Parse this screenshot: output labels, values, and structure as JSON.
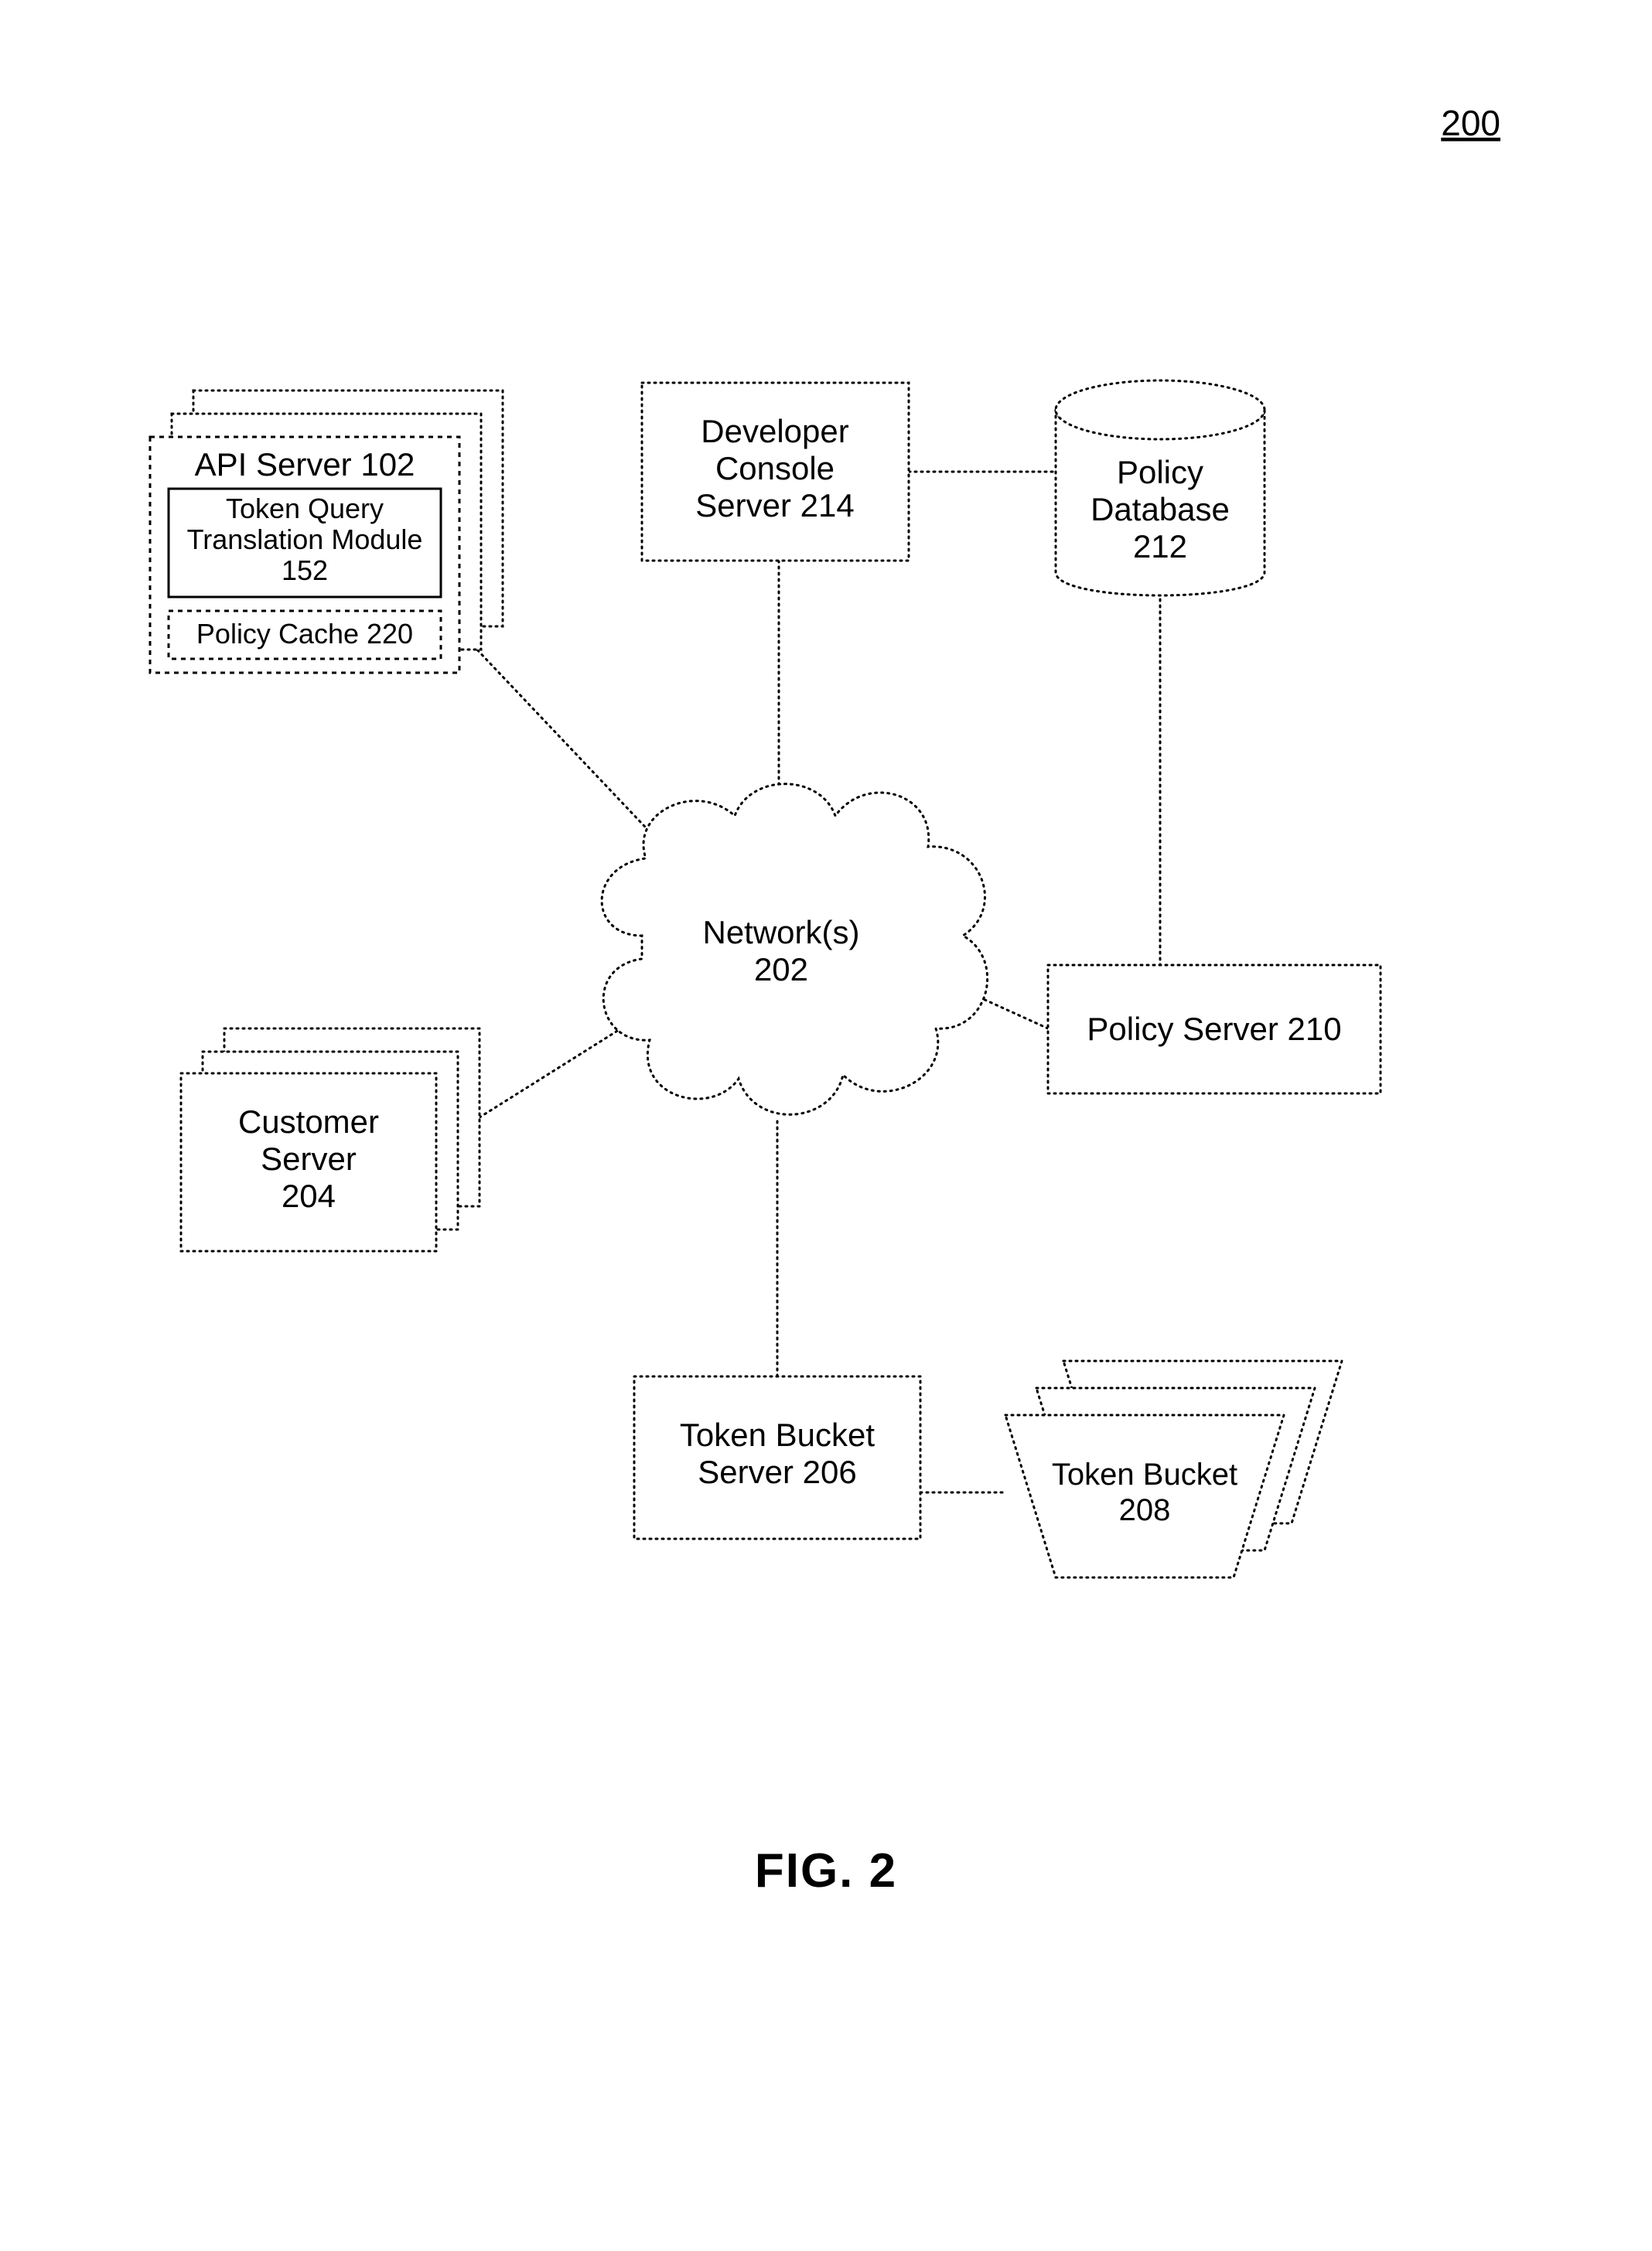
{
  "page_number": "200",
  "figure_caption": "FIG. 2",
  "nodes": {
    "api_server": {
      "title": "API Server 102",
      "module": {
        "l1": "Token Query",
        "l2": "Translation Module",
        "l3": "152"
      },
      "cache": "Policy Cache 220"
    },
    "developer_console": {
      "l1": "Developer",
      "l2": "Console",
      "l3": "Server 214"
    },
    "policy_database": {
      "l1": "Policy",
      "l2": "Database",
      "l3": "212"
    },
    "network": {
      "l1": "Network(s)",
      "l2": "202"
    },
    "customer_server": {
      "l1": "Customer",
      "l2": "Server",
      "l3": "204"
    },
    "policy_server": "Policy Server 210",
    "token_bucket_server": {
      "l1": "Token Bucket",
      "l2": "Server 206"
    },
    "token_bucket": {
      "l1": "Token Bucket",
      "l2": "208"
    }
  }
}
